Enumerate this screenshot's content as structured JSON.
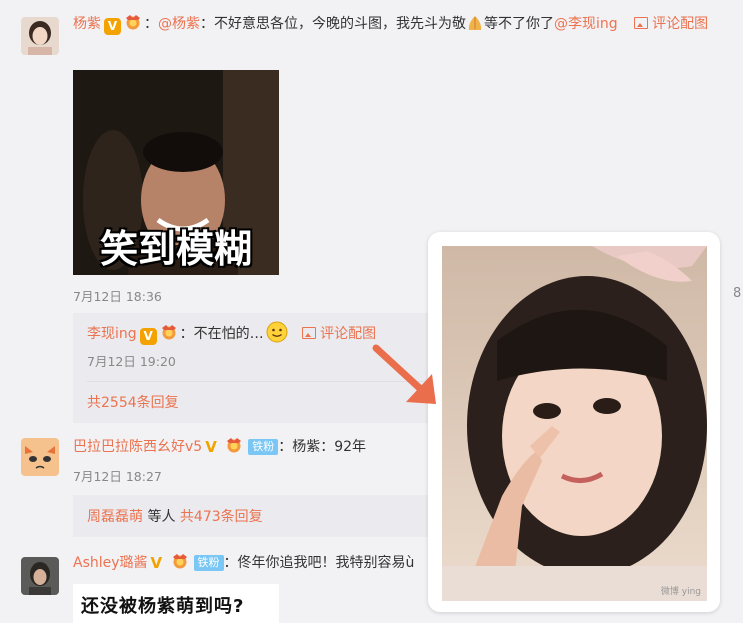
{
  "comment1": {
    "username": "杨紫",
    "text_prefix": "：",
    "mention": "@杨紫",
    "text": "：不好意思各位，今晚的斗图，我先斗为敬",
    "text2": "等不了你了",
    "mention2": "@李现ing",
    "pic_link": "评论配图",
    "meme_caption": "笑到模糊",
    "time": "7月12日 18:36"
  },
  "reply1": {
    "username": "李现ing",
    "text": "：不在怕的…",
    "pic_link": "评论配图",
    "time": "7月12日 19:20",
    "more_replies": "共2554条回复"
  },
  "comment2": {
    "username": "巴拉巴拉陈西幺好v5",
    "fan_badge": "铁粉",
    "text": "：杨紫：92年",
    "time": "7月12日 18:27",
    "reply_name": "周磊磊萌",
    "reply_text": "等人",
    "more_replies": "共473条回复"
  },
  "comment3": {
    "username": "Ashley璐酱",
    "fan_badge": "铁粉",
    "text": "：佟年你追我吧！我特别容易ù",
    "meme_caption": "还没被杨紫萌到吗?"
  },
  "overlay": {
    "watermark": "微博 ying"
  },
  "colors": {
    "link": "#eb7350",
    "badge_orange": "#f3a200",
    "fan_blue": "#7ac6f5",
    "arrow": "#ea6d4c"
  }
}
